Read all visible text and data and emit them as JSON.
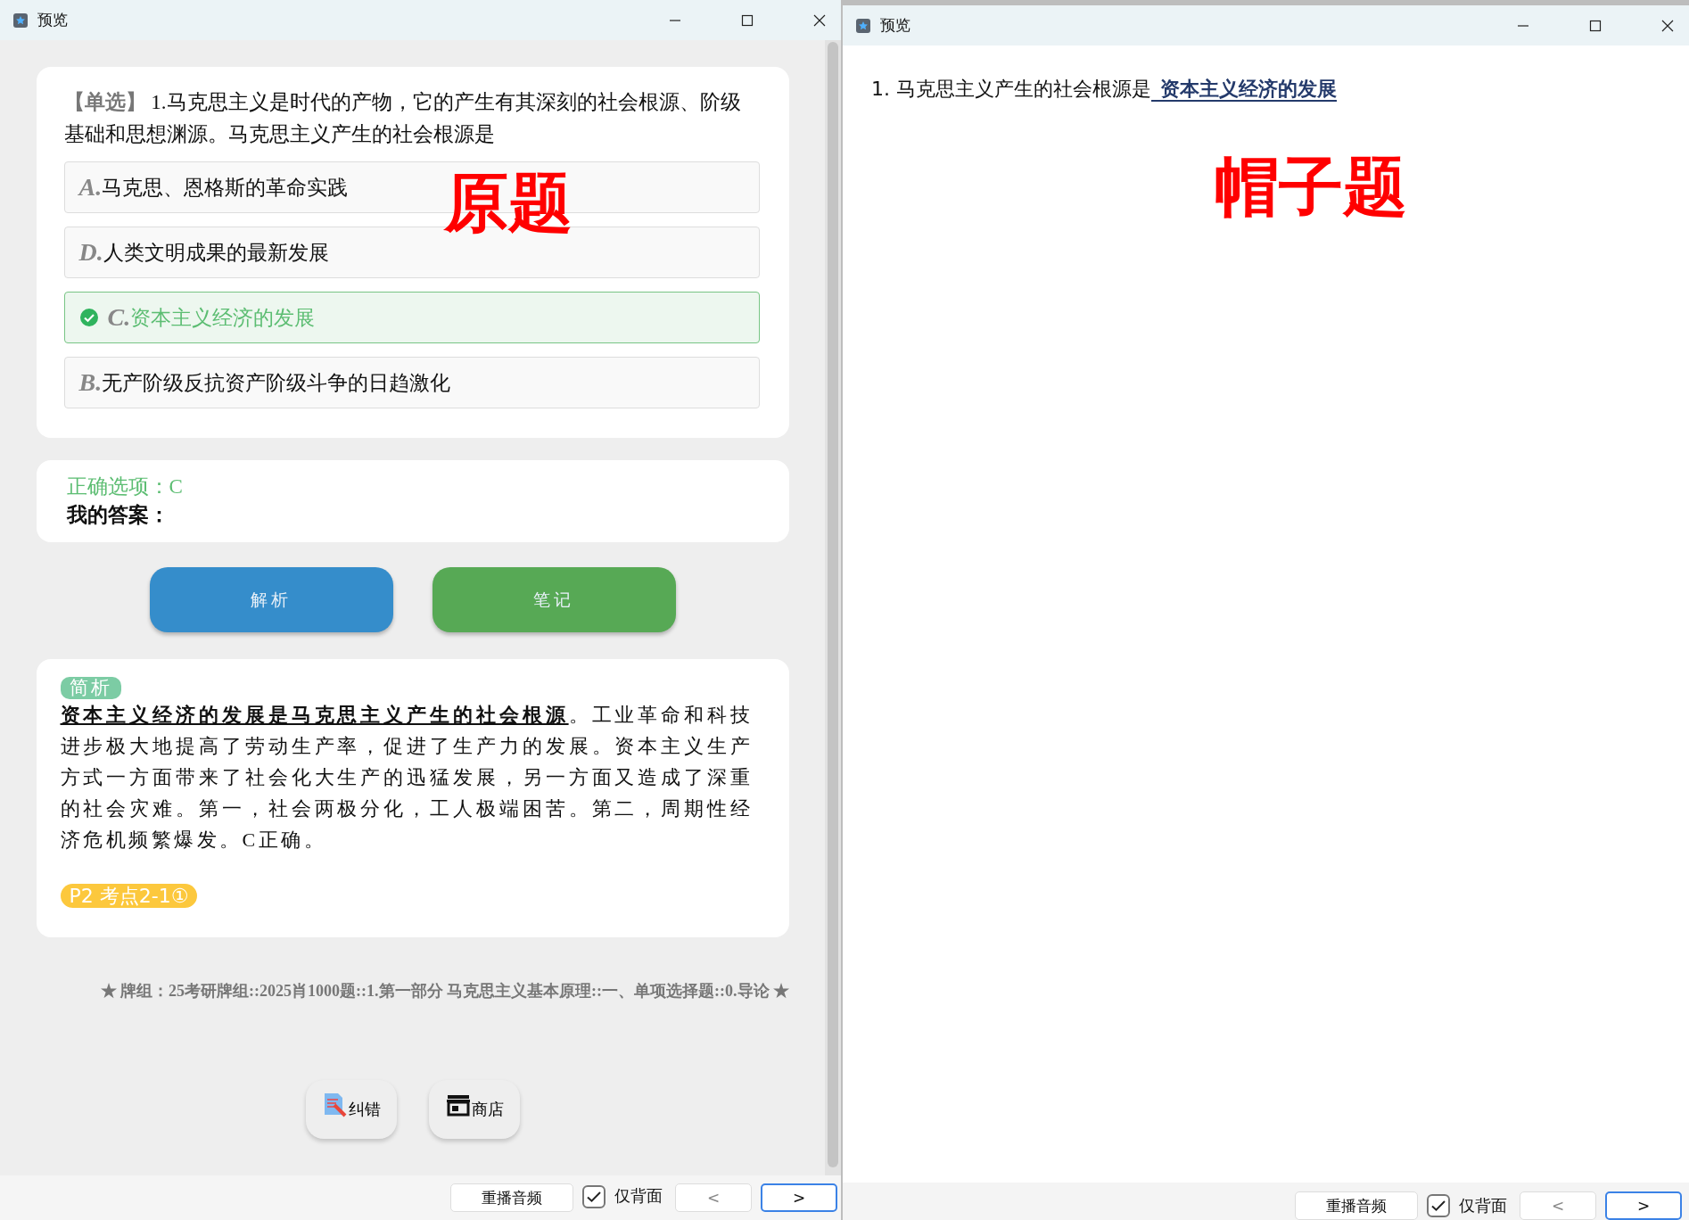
{
  "left_window": {
    "title": "预览",
    "question": {
      "tag": "【单选】",
      "text": "1.马克思主义是时代的产物，它的产生有其深刻的社会根源、阶级基础和思想渊源。马克思主义产生的社会根源是"
    },
    "annotation": "原题",
    "options": [
      {
        "letter": "A.",
        "text": "马克思、恩格斯的革命实践",
        "correct": false
      },
      {
        "letter": "D.",
        "text": "人类文明成果的最新发展",
        "correct": false
      },
      {
        "letter": "C.",
        "text": "资本主义经济的发展",
        "correct": true
      },
      {
        "letter": "B.",
        "text": "无产阶级反抗资产阶级斗争的日趋激化",
        "correct": false
      }
    ],
    "answer_card": {
      "correct_option": "正确选项：C",
      "my_answer": "我的答案："
    },
    "buttons": [
      {
        "label": "解析",
        "color": "#358dcb"
      },
      {
        "label": "笔记",
        "color": "#57a955"
      }
    ],
    "analysis": {
      "tag": "简析",
      "text": "**资本主义经济的发展是马克思主义产生的社会根源**。工业革命和科技进步极大地提高了劳动生产率，促进了生产力的发展。资本主义生产方式一方面带来了社会化大生产的迅猛发展，另一方面又造成了深重的社会灾难。第一，社会两极分化，工人极端困苦。第二，周期性经济危机频繁爆发。C正确。",
      "badge": "P2 考点2-1①"
    },
    "deck": "★ 牌组：25考研牌组::2025肖1000题::1.第一部分 马克思主义基本原理::一、单项选择题::0.导论 ★",
    "tools": [
      {
        "kind": "report",
        "label": "纠错"
      },
      {
        "kind": "store",
        "label": "商店"
      }
    ],
    "bottom_bar": {
      "replay": "重播音频",
      "back_only": {
        "label": "仅背面",
        "checked": true
      },
      "nav": [
        {
          "label": "<",
          "focused": false
        },
        {
          "label": ">",
          "focused": true
        }
      ]
    }
  },
  "right_window": {
    "title": "预览",
    "question": {
      "text": "1. 马克思主义产生的社会根源是",
      "answer": "资本主义经济的发展"
    },
    "annotation": "帽子题",
    "bottom_bar": {
      "replay": "重播音频",
      "back_only": {
        "label": "仅背面",
        "checked": true
      },
      "nav": [
        {
          "label": "<",
          "focused": false
        },
        {
          "label": ">",
          "focused": true
        }
      ]
    }
  }
}
